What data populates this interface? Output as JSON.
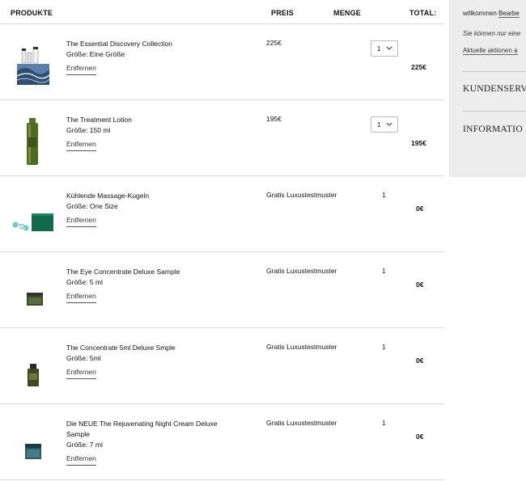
{
  "cart": {
    "headers": {
      "products": "PRODUKTE",
      "price": "PREIS",
      "quantity": "MENGE",
      "total": "TOTAL:"
    },
    "remove_label": "Entfernen",
    "items": [
      {
        "name": "The Essential Discovery Collection",
        "size": "Größe: Eine Größe",
        "price": "225€",
        "quantity": "1",
        "total": "225€"
      },
      {
        "name": "The Treatment Lotion",
        "size": "Größe: 150 ml",
        "price": "195€",
        "quantity": "1",
        "total": "195€"
      },
      {
        "name": "Kühlende Massage-Kugeln",
        "size": "Größe: One Size",
        "price": "Gratis Luxustestmuster",
        "quantity": "1",
        "total": "0€"
      },
      {
        "name": "The Eye Concentrate Deluxe Sample",
        "size": "Größe: 5 ml",
        "price": "Gratis Luxustestmuster",
        "quantity": "1",
        "total": "0€"
      },
      {
        "name": "The Concentrate 5ml Deluxe Smple",
        "size": "Größe: 5ml",
        "price": "Gratis Luxustestmuster",
        "quantity": "1",
        "total": "0€"
      },
      {
        "name": "Die NEUE The Rejuvenating Night Cream Deluxe Sample",
        "size": "Größe: 7 ml",
        "price": "Gratis Luxustestmuster",
        "quantity": "1",
        "total": "0€"
      }
    ]
  },
  "sidebar": {
    "welcome": "willkommen",
    "edit_link": "Bearbe",
    "note": "Sie können nur eine",
    "promotions_link": "Aktuelle aktionen a",
    "customer_service": "KUNDENSERV",
    "information": "INFORMATIO"
  },
  "colors": {
    "sidebar_bg": "#ededed",
    "divider": "#d9d9d9"
  }
}
